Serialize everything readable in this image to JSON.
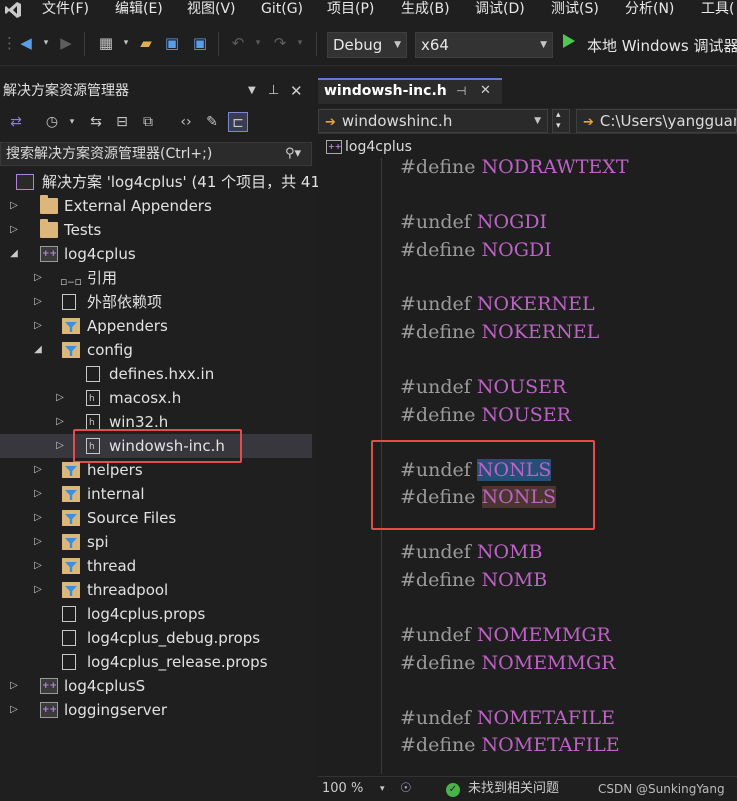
{
  "menubar": {
    "items": [
      "文件(F)",
      "编辑(E)",
      "视图(V)",
      "Git(G)",
      "项目(P)",
      "生成(B)",
      "调试(D)",
      "测试(S)",
      "分析(N)",
      "工具("
    ]
  },
  "toolbar": {
    "config": "Debug",
    "platform": "x64",
    "run_label": "本地 Windows 调试器"
  },
  "solution_explorer": {
    "title": "解决方案资源管理器",
    "search_placeholder": "搜索解决方案资源管理器(Ctrl+;)",
    "solution_label": "解决方案 'log4cplus' (41 个项目，共 41",
    "items": [
      {
        "label": "External Appenders",
        "icon": "folder-icon"
      },
      {
        "label": "Tests",
        "icon": "folder-icon"
      },
      {
        "label": "log4cplus",
        "icon": "cpp-project-icon"
      },
      {
        "label": "引用",
        "icon": "references-icon"
      },
      {
        "label": "外部依赖项",
        "icon": "external-deps-icon"
      },
      {
        "label": "Appenders",
        "icon": "filter-folder-icon"
      },
      {
        "label": "config",
        "icon": "filter-folder-icon"
      },
      {
        "label": "defines.hxx.in",
        "icon": "file-icon"
      },
      {
        "label": "macosx.h",
        "icon": "header-file-icon"
      },
      {
        "label": "win32.h",
        "icon": "header-file-icon"
      },
      {
        "label": "windowsh-inc.h",
        "icon": "header-file-icon"
      },
      {
        "label": "helpers",
        "icon": "filter-folder-icon"
      },
      {
        "label": "internal",
        "icon": "filter-folder-icon"
      },
      {
        "label": "Source Files",
        "icon": "filter-folder-icon"
      },
      {
        "label": "spi",
        "icon": "filter-folder-icon"
      },
      {
        "label": "thread",
        "icon": "filter-folder-icon"
      },
      {
        "label": "threadpool",
        "icon": "filter-folder-icon"
      },
      {
        "label": "log4cplus.props",
        "icon": "props-file-icon"
      },
      {
        "label": "log4cplus_debug.props",
        "icon": "props-file-icon"
      },
      {
        "label": "log4cplus_release.props",
        "icon": "props-file-icon"
      },
      {
        "label": "log4cplusS",
        "icon": "cpp-project-icon"
      },
      {
        "label": "loggingserver",
        "icon": "cpp-project-icon"
      }
    ]
  },
  "editor": {
    "tab_title": "windowsh-inc.h",
    "nav_file": "windowshinc.h",
    "nav_path": "C:\\Users\\yangguan",
    "project_crumb": "log4cplus",
    "code_lines": [
      {
        "kw": "#define",
        "mac": "NODRAWTEXT"
      },
      {
        "kw": "#undef",
        "mac": "NOGDI"
      },
      {
        "kw": "#define",
        "mac": "NOGDI"
      },
      {
        "kw": "#undef",
        "mac": "NOKERNEL"
      },
      {
        "kw": "#define",
        "mac": "NOKERNEL"
      },
      {
        "kw": "#undef",
        "mac": "NOUSER"
      },
      {
        "kw": "#define",
        "mac": "NOUSER"
      },
      {
        "kw": "#undef",
        "mac": "NONLS"
      },
      {
        "kw": "#define",
        "mac": "NONLS"
      },
      {
        "kw": "#undef",
        "mac": "NOMB"
      },
      {
        "kw": "#define",
        "mac": "NOMB"
      },
      {
        "kw": "#undef",
        "mac": "NOMEMMGR"
      },
      {
        "kw": "#define",
        "mac": "NOMEMMGR"
      },
      {
        "kw": "#undef",
        "mac": "NOMETAFILE"
      },
      {
        "kw": "#define",
        "mac": "NOMETAFILE"
      }
    ]
  },
  "statusbar": {
    "zoom": "100 %",
    "issues": "未找到相关问题",
    "watermark": "CSDN @SunkingYang"
  },
  "colors": {
    "accent": "#5c7bdc",
    "macro": "#bd63c5",
    "highlight_box": "#e34d4d",
    "success": "#49b34a"
  }
}
